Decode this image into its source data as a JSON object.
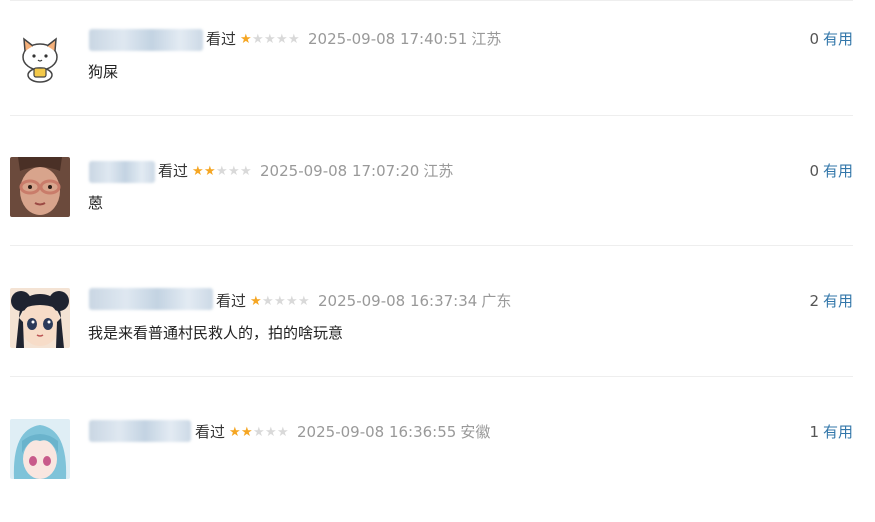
{
  "comments": [
    {
      "watched_label": "看过",
      "rating_stars": 1,
      "time": "2025-09-08 17:40:51",
      "location": "江苏",
      "useful_count": "0",
      "useful_label": "有用",
      "content": "狗屎"
    },
    {
      "watched_label": "看过",
      "rating_stars": 2,
      "time": "2025-09-08 17:07:20",
      "location": "江苏",
      "useful_count": "0",
      "useful_label": "有用",
      "content": "蒽"
    },
    {
      "watched_label": "看过",
      "rating_stars": 1,
      "time": "2025-09-08 16:37:34",
      "location": "广东",
      "useful_count": "2",
      "useful_label": "有用",
      "content": "我是来看普通村民救人的，拍的啥玩意"
    },
    {
      "watched_label": "看过",
      "rating_stars": 2,
      "time": "2025-09-08 16:36:55",
      "location": "安徽",
      "useful_count": "1",
      "useful_label": "有用",
      "content": ""
    }
  ],
  "star_max": 5,
  "colors": {
    "star_on": "#f5a623",
    "star_off": "#d9d9d9",
    "link": "#3377aa",
    "meta": "#999999"
  }
}
